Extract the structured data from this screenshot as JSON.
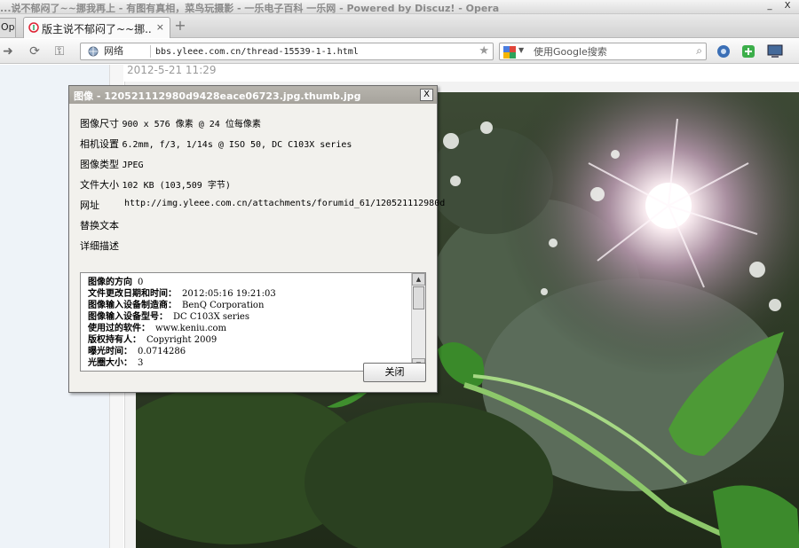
{
  "window": {
    "title": "...说不郁闷了~~挪我再上 - 有图有真相，菜鸟玩摄影 - 一乐电子百科 一乐网 - Powered by Discuz! - Opera",
    "minimize": "_",
    "close": "X"
  },
  "tabs": {
    "side_label": "Opera",
    "active_label": "版主说不郁闷了~~挪...",
    "close_glyph": "×",
    "new_tab_glyph": "+"
  },
  "address_bar": {
    "site_label": "网络",
    "url": "bbs.yleee.com.cn/thread-15539-1-1.html"
  },
  "search": {
    "placeholder": "使用Google搜索"
  },
  "page": {
    "post_date": "2012-5-21 11:29"
  },
  "dialog": {
    "title": "图像 - 120521112980d9428eace06723.jpg.thumb.jpg",
    "close_glyph": "X",
    "rows": [
      {
        "label": "图像尺寸",
        "value": "900 x 576 像素 @ 24 位每像素"
      },
      {
        "label": "相机设置",
        "value": "6.2mm, f/3, 1/14s @ ISO 50, DC C103X series"
      },
      {
        "label": "图像类型",
        "value": "JPEG"
      },
      {
        "label": "文件大小",
        "value": "102 KB (103,509 字节)"
      },
      {
        "label": "网址",
        "value": "http://img.yleee.com.cn/attachments/forumid_61/120521112980d"
      },
      {
        "label": "替换文本",
        "value": ""
      },
      {
        "label": "详细描述",
        "value": ""
      }
    ],
    "details": [
      {
        "key": "图像的方向",
        "value": "0"
      },
      {
        "key": "文件更改日期和时间：",
        "value": "2012:05:16 19:21:03"
      },
      {
        "key": "图像输入设备制造商：",
        "value": "BenQ Corporation"
      },
      {
        "key": "图像输入设备型号：",
        "value": "DC C103X series"
      },
      {
        "key": "使用过的软件：",
        "value": "www.keniu.com"
      },
      {
        "key": "版权持有人：",
        "value": "Copyright 2009"
      },
      {
        "key": "曝光时间：",
        "value": "0.0714286"
      },
      {
        "key": "光圈大小：",
        "value": "3"
      }
    ],
    "ok_button": "关闭"
  },
  "colors": {
    "dialog_bg": "#d4d0c8",
    "dialog_title": "#a6a39c",
    "left_panel": "#eef3f8"
  }
}
